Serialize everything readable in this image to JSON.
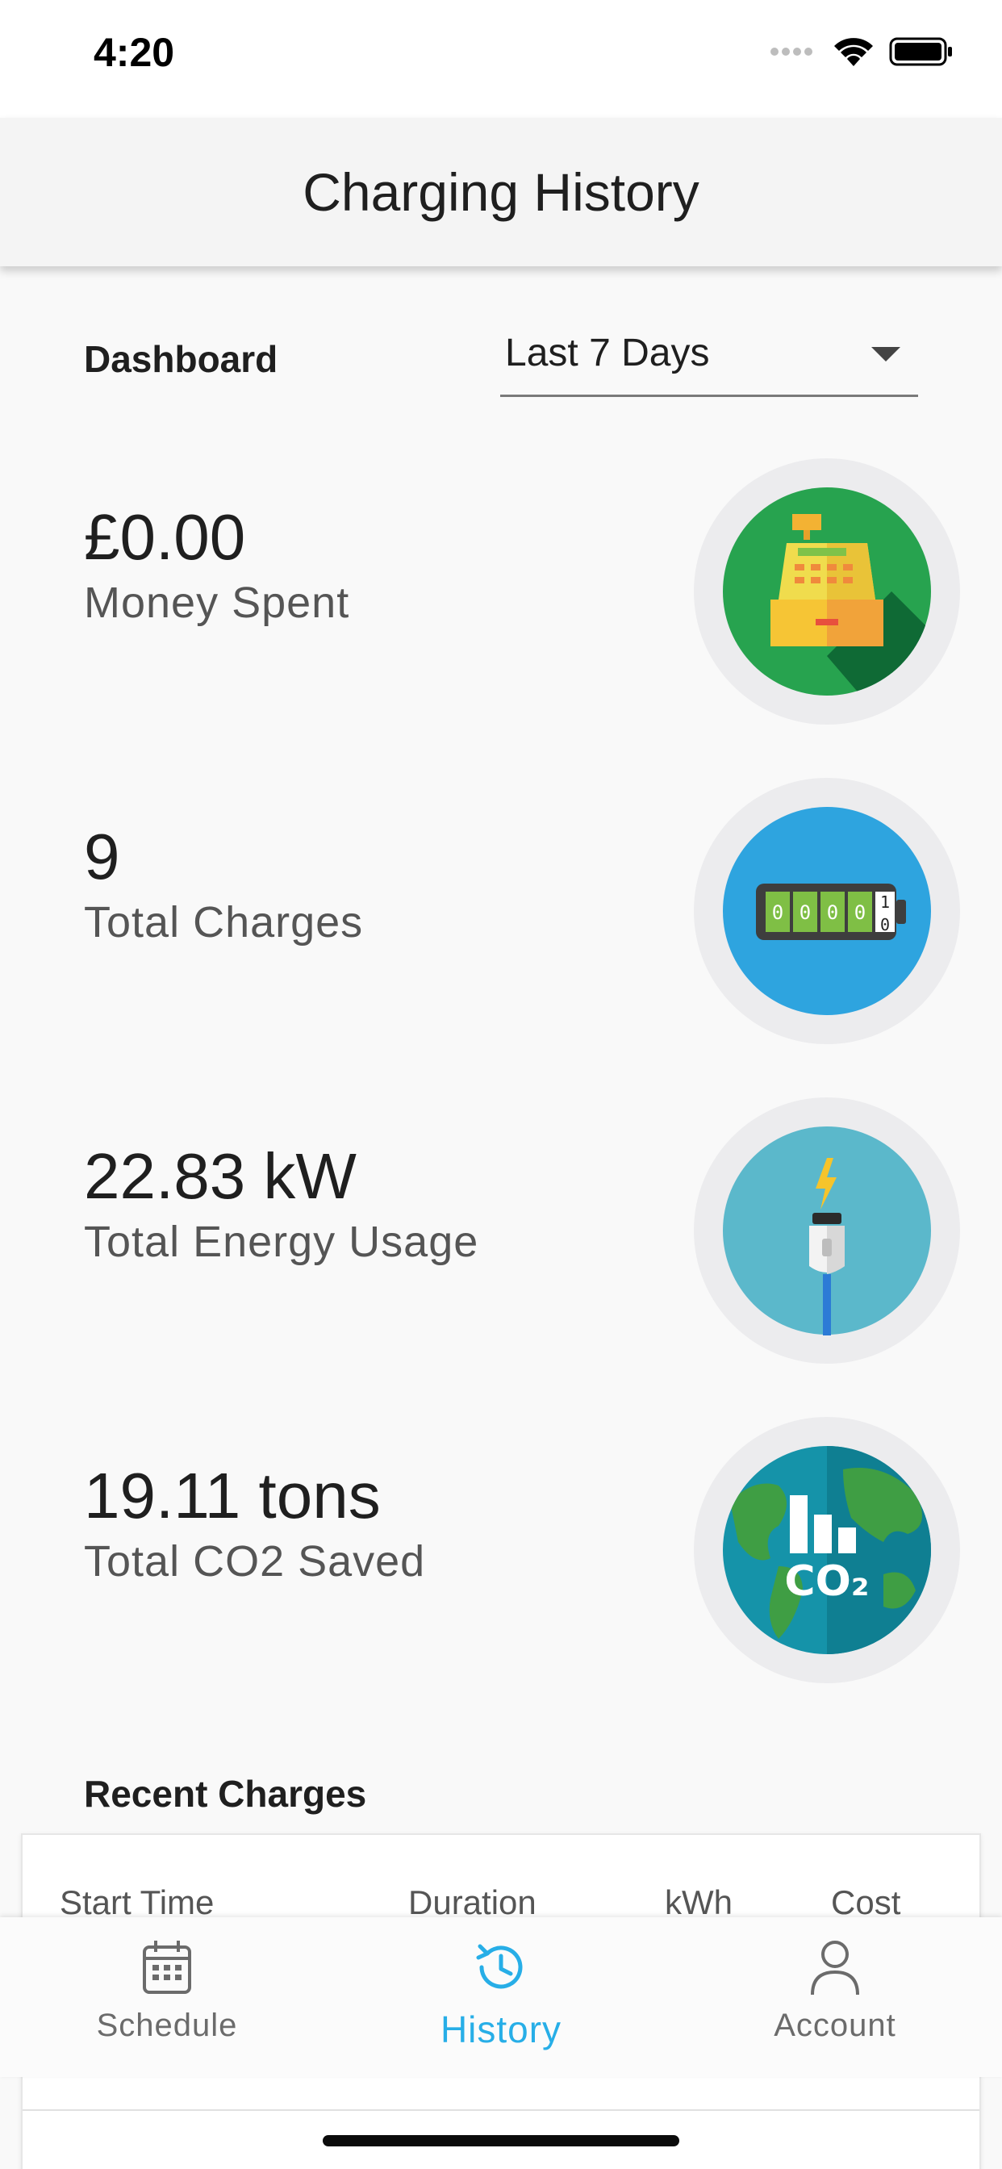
{
  "status_bar": {
    "time": "4:20"
  },
  "header": {
    "title": "Charging History"
  },
  "dashboard": {
    "label": "Dashboard",
    "period_selected": "Last 7 Days"
  },
  "stats": [
    {
      "value": "£0.00",
      "label": "Money Spent",
      "icon": "cash-register-icon"
    },
    {
      "value": "9",
      "label": "Total Charges",
      "icon": "charge-counter-icon",
      "counter_digits": [
        "0",
        "0",
        "0",
        "0",
        "1",
        "0"
      ]
    },
    {
      "value": "22.83 kW",
      "label": "Total Energy Usage",
      "icon": "ev-plug-icon"
    },
    {
      "value": "19.11 tons",
      "label": "Total CO2 Saved",
      "icon": "co2-globe-icon",
      "icon_text": "CO₂"
    }
  ],
  "recent": {
    "title": "Recent Charges",
    "columns": [
      "Start Time",
      "Duration",
      "kWh",
      "Cost"
    ]
  },
  "tabs": [
    {
      "label": "Schedule",
      "icon": "calendar-icon",
      "active": false
    },
    {
      "label": "History",
      "icon": "history-icon",
      "active": true
    },
    {
      "label": "Account",
      "icon": "person-icon",
      "active": false
    }
  ],
  "colors": {
    "accent": "#27aee7",
    "money_bg": "#27a34f",
    "charges_bg": "#2ea4df",
    "energy_bg": "#5bb8cb",
    "co2_bg": "#1593a9"
  }
}
